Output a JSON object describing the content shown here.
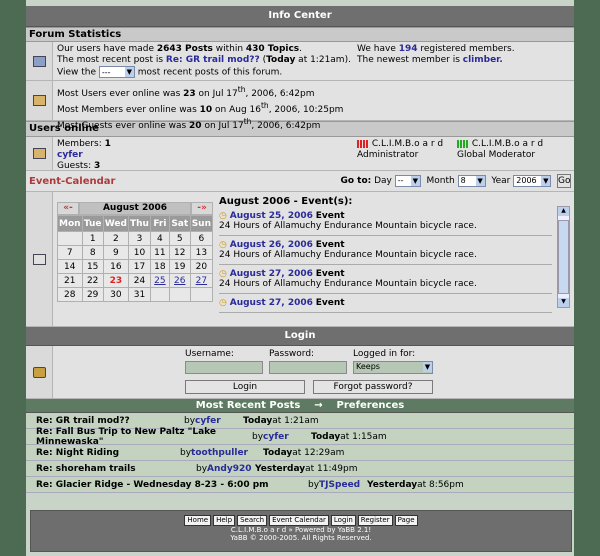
{
  "header": {
    "title": "Info Center"
  },
  "forum_stats": {
    "section_title": "Forum Statistics",
    "line1_pre": "Our users have made ",
    "posts": "2643 Posts",
    "line1_mid": " within ",
    "topics": "430 Topics",
    "line1_end": ".",
    "line2_pre": "The most recent post is ",
    "recent_post": "Re: GR trail mod??",
    "recent_time_pre": " (",
    "recent_time_day": "Today",
    "recent_time_post": " at 1:21am).",
    "view_pre": "View the",
    "view_select": "---",
    "view_post": "most recent posts of this forum.",
    "members_pre": "We have ",
    "members_count": "194",
    "members_post": " registered members.",
    "newest_pre": "The newest member is ",
    "newest_member": "climber."
  },
  "online_records": {
    "line1_pre": "Most Users ever online was ",
    "line1_n": "23",
    "line1_post": " on Jul 17",
    "line1_sup": "th",
    "line1_end": ", 2006, 6:42pm",
    "line2_pre": "Most Members ever online was ",
    "line2_n": "10",
    "line2_post": " on Aug 16",
    "line2_sup": "th",
    "line2_end": ", 2006, 10:25pm",
    "line3_pre": "Most Guests ever online was ",
    "line3_n": "20",
    "line3_post": " on Jul 17",
    "line3_sup": "th",
    "line3_end": ", 2006, 6:42pm"
  },
  "users_online": {
    "section_title": "Users online",
    "members_label": "Members: ",
    "members_n": "1",
    "user": "cyfer",
    "guests_label": "Guests: ",
    "guests_n": "3",
    "legend1_name": "C.L.I.M.B.o a r d",
    "legend1_role": "Administrator",
    "legend2_name": "C.L.I.M.B.o a r d",
    "legend2_role": "Global Moderator"
  },
  "calendar": {
    "section_title": "Event-Calendar",
    "goto_label": "Go to:",
    "day_label": "Day",
    "day_value": "--",
    "month_label": "Month",
    "month_value": "8",
    "year_label": "Year",
    "year_value": "2006",
    "go_button": "Go",
    "prev": "«-",
    "next": "-»",
    "month_title": "August 2006",
    "weekdays": [
      "Mon",
      "Tue",
      "Wed",
      "Thu",
      "Fri",
      "Sat",
      "Sun"
    ],
    "weeks": [
      [
        "",
        "1",
        "2",
        "3",
        "4",
        "5",
        "6"
      ],
      [
        "7",
        "8",
        "9",
        "10",
        "11",
        "12",
        "13"
      ],
      [
        "14",
        "15",
        "16",
        "17",
        "18",
        "19",
        "20"
      ],
      [
        "21",
        "22",
        "23",
        "24",
        "25",
        "26",
        "27"
      ],
      [
        "28",
        "29",
        "30",
        "31",
        "",
        "",
        ""
      ]
    ],
    "events_header": "August 2006 - Event(s):",
    "events": [
      {
        "date": "August 25, 2006",
        "type": "Event",
        "desc": "24 Hours of Allamuchy Endurance Mountain bicycle race."
      },
      {
        "date": "August 26, 2006",
        "type": "Event",
        "desc": "24 Hours of Allamuchy Endurance Mountain bicycle race."
      },
      {
        "date": "August 27, 2006",
        "type": "Event",
        "desc": "24 Hours of Allamuchy Endurance Mountain bicycle race."
      },
      {
        "date": "August 27, 2006",
        "type": "Event",
        "desc": ""
      }
    ]
  },
  "login": {
    "title": "Login",
    "username_label": "Username:",
    "password_label": "Password:",
    "logged_label": "Logged in for:",
    "logged_value": "Keeps",
    "login_button": "Login",
    "forgot_button": "Forgot password?"
  },
  "recent": {
    "title": "Most Recent Posts",
    "arrow": "→",
    "prefs": "Preferences",
    "posts": [
      {
        "title": "Re: GR trail mod??",
        "by": "by ",
        "user": "cyfer",
        "day": "Today",
        "time": " at 1:21am"
      },
      {
        "title": "Re: Fall Bus Trip to New Paltz \"Lake Minnewaska\"",
        "by": "by ",
        "user": "cyfer",
        "day": "Today",
        "time": " at 1:15am"
      },
      {
        "title": "Re: Night Riding",
        "by": "by ",
        "user": "toothpuller",
        "day": "Today",
        "time": " at 12:29am"
      },
      {
        "title": "Re: shoreham trails",
        "by": "by ",
        "user": "Andy920",
        "day": "Yesterday",
        "time": " at 11:49pm"
      },
      {
        "title": "Re: Glacier Ridge - Wednesday 8-23 - 6:00 pm",
        "by": "by ",
        "user": "TJSpeed",
        "day": "Yesterday",
        "time": " at 8:56pm"
      }
    ]
  },
  "footer": {
    "buttons": [
      "Home",
      "Help",
      "Search",
      "Event Calendar",
      "Login",
      "Register",
      "Page"
    ],
    "line1": "C.L.I.M.B.o a r d » Powered by YaBB 2.1!",
    "line2": "YaBB © 2000-2005. All Rights Reserved."
  }
}
